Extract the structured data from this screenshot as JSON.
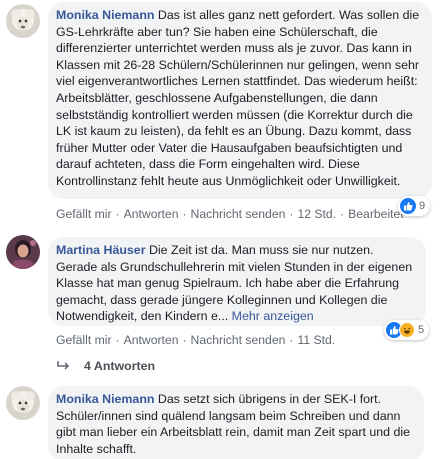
{
  "comments": [
    {
      "author": "Monika Niemann",
      "text": "Das ist alles ganz nett gefordert. Was sollen die GS-Lehrkräfte aber tun? Sie haben eine Schülerschaft, die differenzierter unterrichtet werden muss als je zuvor. Das kann in Klassen mit 26-28 Schülern/Schülerinnen nur gelingen, wenn sehr viel eigenverantwortliches Lernen stattfindet. Das wiederum heißt: Arbeitsblätter, geschlossene Aufgabenstellungen, die dann selbstständig kontrolliert werden müssen (die Korrektur durch die LK ist kaum zu leisten), da fehlt es an Übung. Dazu kommt, dass früher Mutter oder Vater die Hausaufgaben beaufsichtigten und darauf achteten, dass die Form eingehalten wird. Diese Kontrollinstanz fehlt heute aus Unmöglichkeit oder Unwilligkeit.",
      "actions": {
        "like": "Gefällt mir",
        "reply": "Antworten",
        "message": "Nachricht senden",
        "time": "12 Std.",
        "edited": "Bearbeitet"
      },
      "reaction_count": "9",
      "reaction_icons": [
        "like-icon"
      ]
    },
    {
      "author": "Martina Häuser",
      "text": "Die Zeit ist da. Man muss sie nur nutzen. Gerade als Grundschullehrerin mit vielen Stunden in der eigenen Klasse hat man genug Spielraum. Ich habe aber die Erfahrung gemacht, dass gerade jüngere Kolleginnen und Kollegen die Notwendigkeit, den Kindern e...",
      "more": "Mehr anzeigen",
      "actions": {
        "like": "Gefällt mir",
        "reply": "Antworten",
        "message": "Nachricht senden",
        "time": "11 Std."
      },
      "reaction_count": "5",
      "reaction_icons": [
        "like-icon",
        "haha-icon"
      ]
    },
    {
      "author": "Monika Niemann",
      "text": "Das setzt sich übrigens in der SEK-I fort. Schüler/innen sind quälend langsam beim Schreiben und dann gibt man lieber ein Arbeitsblatt rein, damit man Zeit spart und die Inhalte schafft."
    }
  ],
  "replies_label": "4 Antworten",
  "colors": {
    "link": "#385898",
    "bubble": "#f2f3f5",
    "meta": "#606770",
    "like": "#1877f2",
    "haha": "#f7b125"
  }
}
